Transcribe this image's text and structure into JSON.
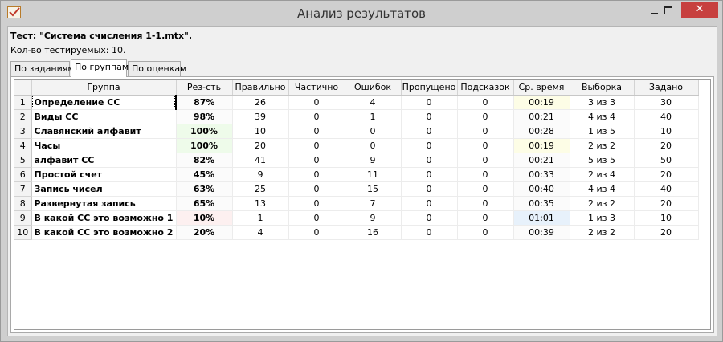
{
  "window": {
    "title": "Анализ результатов",
    "close_glyph": "✕"
  },
  "info": {
    "test_label": "Тест: \"Система счисления 1-1.mtx\".",
    "count_label": "Кол-во тестируемых: 10."
  },
  "tabs": [
    {
      "label": "По заданиям",
      "active": false
    },
    {
      "label": "По группам",
      "active": true
    },
    {
      "label": "По оценкам",
      "active": false
    }
  ],
  "table": {
    "columns": [
      "Группа",
      "Рез-сть",
      "Правильно",
      "Частично",
      "Ошибок",
      "Пропущено",
      "Подсказок",
      "Ср. время",
      "Выборка",
      "Задано"
    ],
    "rows": [
      {
        "n": "1",
        "group": "Определение СС",
        "result": "87%",
        "correct": "26",
        "partial": "0",
        "errors": "4",
        "skipped": "0",
        "hints": "0",
        "avg_time": "00:19",
        "sample": "3 из 3",
        "given": "30",
        "result_bg": "#fbfbfb",
        "time_bg": "#fdfde6"
      },
      {
        "n": "2",
        "group": "Виды СС",
        "result": "98%",
        "correct": "39",
        "partial": "0",
        "errors": "1",
        "skipped": "0",
        "hints": "0",
        "avg_time": "00:21",
        "sample": "4 из 4",
        "given": "40",
        "result_bg": "#fbfbfb",
        "time_bg": "#fbfbfb"
      },
      {
        "n": "3",
        "group": "Славянский алфавит",
        "result": "100%",
        "correct": "10",
        "partial": "0",
        "errors": "0",
        "skipped": "0",
        "hints": "0",
        "avg_time": "00:28",
        "sample": "1 из 5",
        "given": "10",
        "result_bg": "#eefbea",
        "time_bg": "#fbfbfb"
      },
      {
        "n": "4",
        "group": "Часы",
        "result": "100%",
        "correct": "20",
        "partial": "0",
        "errors": "0",
        "skipped": "0",
        "hints": "0",
        "avg_time": "00:19",
        "sample": "2 из 2",
        "given": "20",
        "result_bg": "#eefbea",
        "time_bg": "#fdfde6"
      },
      {
        "n": "5",
        "group": "алфавит СС",
        "result": "82%",
        "correct": "41",
        "partial": "0",
        "errors": "9",
        "skipped": "0",
        "hints": "0",
        "avg_time": "00:21",
        "sample": "5 из 5",
        "given": "50",
        "result_bg": "#fbfbfb",
        "time_bg": "#fbfbfb"
      },
      {
        "n": "6",
        "group": "Простой счет",
        "result": "45%",
        "correct": "9",
        "partial": "0",
        "errors": "11",
        "skipped": "0",
        "hints": "0",
        "avg_time": "00:33",
        "sample": "2 из 4",
        "given": "20",
        "result_bg": "#fbfbfb",
        "time_bg": "#fbfbfb"
      },
      {
        "n": "7",
        "group": "Запись чисел",
        "result": "63%",
        "correct": "25",
        "partial": "0",
        "errors": "15",
        "skipped": "0",
        "hints": "0",
        "avg_time": "00:40",
        "sample": "4 из 4",
        "given": "40",
        "result_bg": "#fbfbfb",
        "time_bg": "#fbfbfb"
      },
      {
        "n": "8",
        "group": "Развернутая запись",
        "result": "65%",
        "correct": "13",
        "partial": "0",
        "errors": "7",
        "skipped": "0",
        "hints": "0",
        "avg_time": "00:35",
        "sample": "2 из 2",
        "given": "20",
        "result_bg": "#fbfbfb",
        "time_bg": "#fbfbfb"
      },
      {
        "n": "9",
        "group": "В какой СС это возможно 1",
        "result": "10%",
        "correct": "1",
        "partial": "0",
        "errors": "9",
        "skipped": "0",
        "hints": "0",
        "avg_time": "01:01",
        "sample": "1 из 3",
        "given": "10",
        "result_bg": "#fdf0f0",
        "time_bg": "#e7f1fb"
      },
      {
        "n": "10",
        "group": "В какой СС это возможно 2",
        "result": "20%",
        "correct": "4",
        "partial": "0",
        "errors": "16",
        "skipped": "0",
        "hints": "0",
        "avg_time": "00:39",
        "sample": "2 из 2",
        "given": "20",
        "result_bg": "#fbfbfb",
        "time_bg": "#fbfbfb"
      }
    ]
  }
}
